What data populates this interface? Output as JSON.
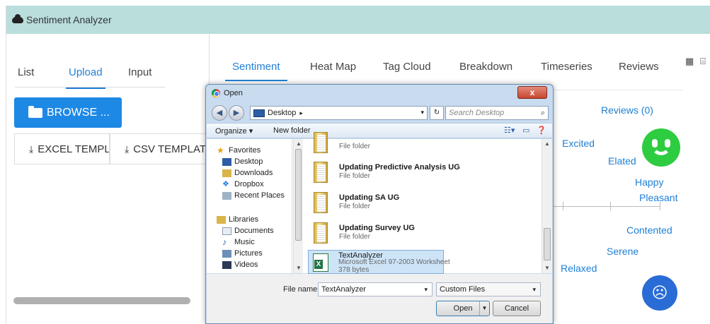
{
  "app": {
    "title": "Sentiment Analyzer"
  },
  "left": {
    "tabs": [
      {
        "label": "List"
      },
      {
        "label": "Upload"
      },
      {
        "label": "Input"
      }
    ],
    "browse_label": "BROWSE ...",
    "excel_template_label": "EXCEL TEMPLATE",
    "csv_template_label": "CSV TEMPLATE"
  },
  "right": {
    "tabs": [
      {
        "label": "Sentiment"
      },
      {
        "label": "Heat Map"
      },
      {
        "label": "Tag Cloud"
      },
      {
        "label": "Breakdown"
      },
      {
        "label": "Timeseries"
      },
      {
        "label": "Reviews"
      }
    ],
    "reviews_count": "Reviews (0)",
    "emotions": {
      "excited": "Excited",
      "elated": "Elated",
      "happy": "Happy",
      "pleasant": "Pleasant",
      "contented": "Contented",
      "serene": "Serene",
      "relaxed": "Relaxed"
    }
  },
  "dialog": {
    "title": "Open",
    "close_label": "x",
    "address": "Desktop",
    "search_placeholder": "Search Desktop",
    "toolbar": {
      "organize": "Organize ▾",
      "new_folder": "New folder"
    },
    "nav": {
      "favorites": "Favorites",
      "desktop": "Desktop",
      "downloads": "Downloads",
      "dropbox": "Dropbox",
      "recent_places": "Recent Places",
      "libraries": "Libraries",
      "documents": "Documents",
      "music": "Music",
      "pictures": "Pictures",
      "videos": "Videos"
    },
    "files": [
      {
        "name": "",
        "type": "File folder"
      },
      {
        "name": "Updating Predictive Analysis UG",
        "type": "File folder"
      },
      {
        "name": "Updating SA UG",
        "type": "File folder"
      },
      {
        "name": "Updating Survey UG",
        "type": "File folder"
      },
      {
        "name": "TextAnalyzer",
        "type": "Microsoft Excel 97-2003 Worksheet",
        "size": "378 bytes"
      }
    ],
    "file_name_label": "File name:",
    "file_name_value": "TextAnalyzer",
    "file_type_value": "Custom Files",
    "open_label": "Open",
    "cancel_label": "Cancel"
  },
  "colors": {
    "accent": "#1e88e5",
    "header": "#b9dedc",
    "positive": "#2ecc40",
    "negative": "#2a6cd6"
  }
}
